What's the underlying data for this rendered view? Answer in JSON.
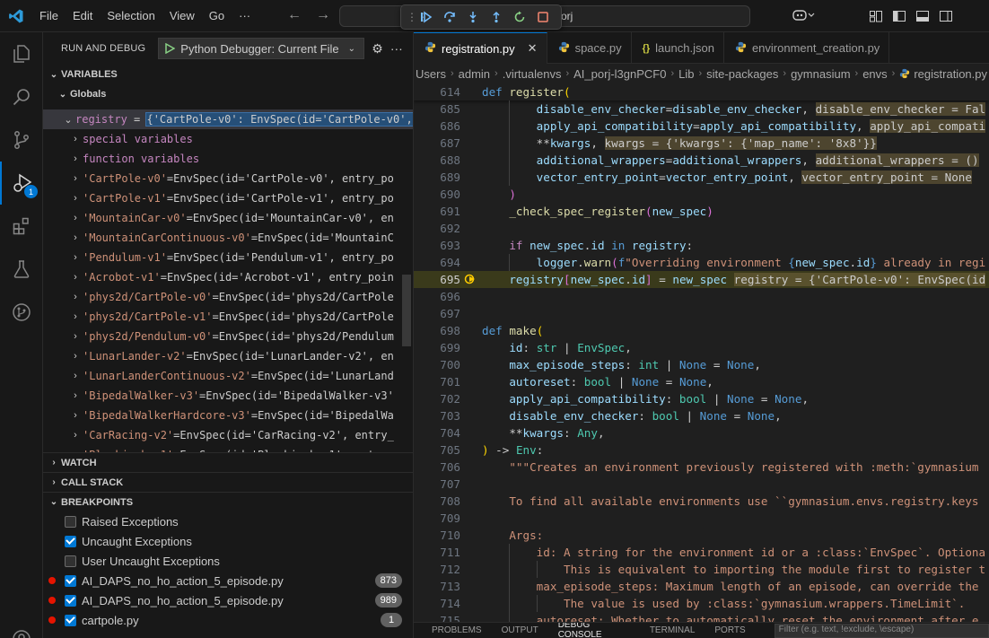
{
  "titlebar": {
    "menu": [
      "File",
      "Edit",
      "Selection",
      "View",
      "Go",
      "···"
    ],
    "command_center_text": "orj"
  },
  "activity": {
    "debug_badge": "1"
  },
  "sidebar": {
    "title": "RUN AND DEBUG",
    "config_label": "Python Debugger: Current File",
    "variables_header": "VARIABLES",
    "globals_header": "Globals",
    "registry_name": "registry",
    "registry_value": "{'CartPole-v0': EnvSpec(id='CartPole-v0', entry_poin",
    "special_vars": "special variables",
    "function_vars": "function variables",
    "entries": [
      {
        "key": "'CartPole-v0'",
        "value": "EnvSpec(id='CartPole-v0', entry_po"
      },
      {
        "key": "'CartPole-v1'",
        "value": "EnvSpec(id='CartPole-v1', entry_po"
      },
      {
        "key": "'MountainCar-v0'",
        "value": "EnvSpec(id='MountainCar-v0', en"
      },
      {
        "key": "'MountainCarContinuous-v0'",
        "value": "EnvSpec(id='MountainC"
      },
      {
        "key": "'Pendulum-v1'",
        "value": "EnvSpec(id='Pendulum-v1', entry_po"
      },
      {
        "key": "'Acrobot-v1'",
        "value": "EnvSpec(id='Acrobot-v1', entry_poin"
      },
      {
        "key": "'phys2d/CartPole-v0'",
        "value": "EnvSpec(id='phys2d/CartPole"
      },
      {
        "key": "'phys2d/CartPole-v1'",
        "value": "EnvSpec(id='phys2d/CartPole"
      },
      {
        "key": "'phys2d/Pendulum-v0'",
        "value": "EnvSpec(id='phys2d/Pendulum"
      },
      {
        "key": "'LunarLander-v2'",
        "value": "EnvSpec(id='LunarLander-v2', en"
      },
      {
        "key": "'LunarLanderContinuous-v2'",
        "value": "EnvSpec(id='LunarLand"
      },
      {
        "key": "'BipedalWalker-v3'",
        "value": "EnvSpec(id='BipedalWalker-v3'"
      },
      {
        "key": "'BipedalWalkerHardcore-v3'",
        "value": "EnvSpec(id='BipedalWa"
      },
      {
        "key": "'CarRacing-v2'",
        "value": "EnvSpec(id='CarRacing-v2', entry_"
      },
      {
        "key": "'Blackjack-v1'",
        "value": "EnvSpec(id='Blackjack-v1', entry_"
      }
    ],
    "watch_header": "WATCH",
    "callstack_header": "CALL STACK",
    "breakpoints_header": "BREAKPOINTS",
    "exception_options": [
      {
        "label": "Raised Exceptions",
        "checked": false
      },
      {
        "label": "Uncaught Exceptions",
        "checked": true
      },
      {
        "label": "User Uncaught Exceptions",
        "checked": false
      }
    ],
    "breakpoint_files": [
      {
        "file": "AI_DAPS_no_ho_action_5_episode.py",
        "line": "873"
      },
      {
        "file": "AI_DAPS_no_ho_action_5_episode.py",
        "line": "989"
      },
      {
        "file": "cartpole.py",
        "line": "1"
      }
    ]
  },
  "editor": {
    "tabs": [
      {
        "label": "registration.py",
        "icon": "python-icon",
        "active": true
      },
      {
        "label": "space.py",
        "icon": "python-icon",
        "active": false
      },
      {
        "label": "launch.json",
        "icon": "json-icon",
        "active": false
      },
      {
        "label": "environment_creation.py",
        "icon": "python-icon",
        "active": false
      }
    ],
    "breadcrumbs": [
      "Users",
      "admin",
      ".virtualenvs",
      "AI_porj-l3gnPCF0",
      "Lib",
      "site-packages",
      "gymnasium",
      "envs",
      "registration.py"
    ],
    "current_line": "695",
    "lines": [
      {
        "n": "614",
        "sticky": true,
        "indent": 0,
        "segs": [
          [
            "kw",
            "def "
          ],
          [
            "fn",
            "register"
          ],
          [
            "br1",
            "("
          ]
        ]
      },
      {
        "n": "685",
        "indent": 2,
        "segs": [
          [
            "prm",
            "disable_env_checker"
          ],
          [
            "plain",
            "="
          ],
          [
            "prm",
            "disable_env_checker"
          ],
          [
            "plain",
            ", "
          ],
          [
            "inl",
            "disable_env_checker = Fal"
          ]
        ]
      },
      {
        "n": "686",
        "indent": 2,
        "segs": [
          [
            "prm",
            "apply_api_compatibility"
          ],
          [
            "plain",
            "="
          ],
          [
            "prm",
            "apply_api_compatibility"
          ],
          [
            "plain",
            ", "
          ],
          [
            "inl",
            "apply_api_compati"
          ]
        ]
      },
      {
        "n": "687",
        "indent": 2,
        "segs": [
          [
            "plain",
            "**"
          ],
          [
            "prm",
            "kwargs"
          ],
          [
            "plain",
            ", "
          ],
          [
            "inl",
            "kwargs = {'kwargs': {'map_name': '8x8'}}"
          ]
        ]
      },
      {
        "n": "688",
        "indent": 2,
        "segs": [
          [
            "prm",
            "additional_wrappers"
          ],
          [
            "plain",
            "="
          ],
          [
            "prm",
            "additional_wrappers"
          ],
          [
            "plain",
            ", "
          ],
          [
            "inl",
            "additional_wrappers = ()"
          ]
        ]
      },
      {
        "n": "689",
        "indent": 2,
        "segs": [
          [
            "prm",
            "vector_entry_point"
          ],
          [
            "plain",
            "="
          ],
          [
            "prm",
            "vector_entry_point"
          ],
          [
            "plain",
            ", "
          ],
          [
            "inl",
            "vector_entry_point = None"
          ]
        ]
      },
      {
        "n": "690",
        "indent": 1,
        "segs": [
          [
            "br2",
            ")"
          ]
        ]
      },
      {
        "n": "691",
        "indent": 1,
        "segs": [
          [
            "fn",
            "_check_spec_register"
          ],
          [
            "br2",
            "("
          ],
          [
            "prm",
            "new_spec"
          ],
          [
            "br2",
            ")"
          ]
        ]
      },
      {
        "n": "692",
        "indent": 0,
        "segs": []
      },
      {
        "n": "693",
        "indent": 1,
        "segs": [
          [
            "ctl",
            "if "
          ],
          [
            "prm",
            "new_spec"
          ],
          [
            "plain",
            "."
          ],
          [
            "prm",
            "id"
          ],
          [
            "kw",
            " in "
          ],
          [
            "prm",
            "registry"
          ],
          [
            "plain",
            ":"
          ]
        ]
      },
      {
        "n": "694",
        "indent": 2,
        "segs": [
          [
            "prm",
            "logger"
          ],
          [
            "plain",
            "."
          ],
          [
            "fn",
            "warn"
          ],
          [
            "br2",
            "("
          ],
          [
            "kw",
            "f"
          ],
          [
            "str",
            "\"Overriding environment "
          ],
          [
            "kw",
            "{"
          ],
          [
            "prm",
            "new_spec"
          ],
          [
            "plain",
            "."
          ],
          [
            "prm",
            "id"
          ],
          [
            "kw",
            "}"
          ],
          [
            "str",
            " already in regi"
          ]
        ]
      },
      {
        "n": "695",
        "current": true,
        "indent": 1,
        "segs": [
          [
            "prm",
            "registry"
          ],
          [
            "br2",
            "["
          ],
          [
            "prm",
            "new_spec"
          ],
          [
            "plain",
            "."
          ],
          [
            "prm",
            "id"
          ],
          [
            "br2",
            "]"
          ],
          [
            "plain",
            " = "
          ],
          [
            "prm",
            "new_spec"
          ],
          [
            "plain",
            " "
          ],
          [
            "inl",
            "registry = {'CartPole-v0': EnvSpec(id"
          ]
        ]
      },
      {
        "n": "696",
        "indent": 0,
        "segs": []
      },
      {
        "n": "697",
        "indent": 0,
        "segs": []
      },
      {
        "n": "698",
        "indent": 0,
        "segs": [
          [
            "kw",
            "def "
          ],
          [
            "fn",
            "make"
          ],
          [
            "br1",
            "("
          ]
        ]
      },
      {
        "n": "699",
        "indent": 1,
        "segs": [
          [
            "prm",
            "id"
          ],
          [
            "plain",
            ": "
          ],
          [
            "cls",
            "str"
          ],
          [
            "plain",
            " | "
          ],
          [
            "cls",
            "EnvSpec"
          ],
          [
            "plain",
            ","
          ]
        ]
      },
      {
        "n": "700",
        "indent": 1,
        "segs": [
          [
            "prm",
            "max_episode_steps"
          ],
          [
            "plain",
            ": "
          ],
          [
            "cls",
            "int"
          ],
          [
            "plain",
            " | "
          ],
          [
            "kw",
            "None"
          ],
          [
            "plain",
            " = "
          ],
          [
            "kw",
            "None"
          ],
          [
            "plain",
            ","
          ]
        ]
      },
      {
        "n": "701",
        "indent": 1,
        "segs": [
          [
            "prm",
            "autoreset"
          ],
          [
            "plain",
            ": "
          ],
          [
            "cls",
            "bool"
          ],
          [
            "plain",
            " | "
          ],
          [
            "kw",
            "None"
          ],
          [
            "plain",
            " = "
          ],
          [
            "kw",
            "None"
          ],
          [
            "plain",
            ","
          ]
        ]
      },
      {
        "n": "702",
        "indent": 1,
        "segs": [
          [
            "prm",
            "apply_api_compatibility"
          ],
          [
            "plain",
            ": "
          ],
          [
            "cls",
            "bool"
          ],
          [
            "plain",
            " | "
          ],
          [
            "kw",
            "None"
          ],
          [
            "plain",
            " = "
          ],
          [
            "kw",
            "None"
          ],
          [
            "plain",
            ","
          ]
        ]
      },
      {
        "n": "703",
        "indent": 1,
        "segs": [
          [
            "prm",
            "disable_env_checker"
          ],
          [
            "plain",
            ": "
          ],
          [
            "cls",
            "bool"
          ],
          [
            "plain",
            " | "
          ],
          [
            "kw",
            "None"
          ],
          [
            "plain",
            " = "
          ],
          [
            "kw",
            "None"
          ],
          [
            "plain",
            ","
          ]
        ]
      },
      {
        "n": "704",
        "indent": 1,
        "segs": [
          [
            "plain",
            "**"
          ],
          [
            "prm",
            "kwargs"
          ],
          [
            "plain",
            ": "
          ],
          [
            "cls",
            "Any"
          ],
          [
            "plain",
            ","
          ]
        ]
      },
      {
        "n": "705",
        "indent": 0,
        "segs": [
          [
            "br1",
            ")"
          ],
          [
            "plain",
            " -> "
          ],
          [
            "cls",
            "Env"
          ],
          [
            "plain",
            ":"
          ]
        ]
      },
      {
        "n": "706",
        "indent": 1,
        "segs": [
          [
            "doc",
            "\"\"\"Creates an environment previously registered with :meth:`gymnasium"
          ]
        ]
      },
      {
        "n": "707",
        "indent": 0,
        "segs": []
      },
      {
        "n": "708",
        "indent": 1,
        "segs": [
          [
            "doc",
            "To find all available environments use ``gymnasium.envs.registry.keys"
          ]
        ]
      },
      {
        "n": "709",
        "indent": 0,
        "segs": []
      },
      {
        "n": "710",
        "indent": 1,
        "segs": [
          [
            "doc",
            "Args:"
          ]
        ]
      },
      {
        "n": "711",
        "indent": 2,
        "segs": [
          [
            "doc",
            "id: A string for the environment id or a :class:`EnvSpec`. Optiona"
          ]
        ]
      },
      {
        "n": "712",
        "indent": 3,
        "segs": [
          [
            "doc",
            "This is equivalent to importing the module first to register t"
          ]
        ]
      },
      {
        "n": "713",
        "indent": 2,
        "segs": [
          [
            "doc",
            "max_episode_steps: Maximum length of an episode, can override the"
          ]
        ]
      },
      {
        "n": "714",
        "indent": 3,
        "segs": [
          [
            "doc",
            "The value is used by :class:`gymnasium.wrappers.TimeLimit`."
          ]
        ]
      },
      {
        "n": "715",
        "indent": 2,
        "segs": [
          [
            "doc",
            "autoreset: Whether to automatically reset the environment after e"
          ]
        ]
      }
    ]
  },
  "panel": {
    "tabs": [
      "PROBLEMS",
      "OUTPUT",
      "DEBUG CONSOLE",
      "TERMINAL",
      "PORTS"
    ],
    "active": "DEBUG CONSOLE",
    "filter_placeholder": "Filter (e.g. text, !exclude, \\escape)"
  },
  "colors": {
    "accent": "#0078d4",
    "breakpoint": "#e51400",
    "current_line_highlight": "#ffcc00"
  }
}
